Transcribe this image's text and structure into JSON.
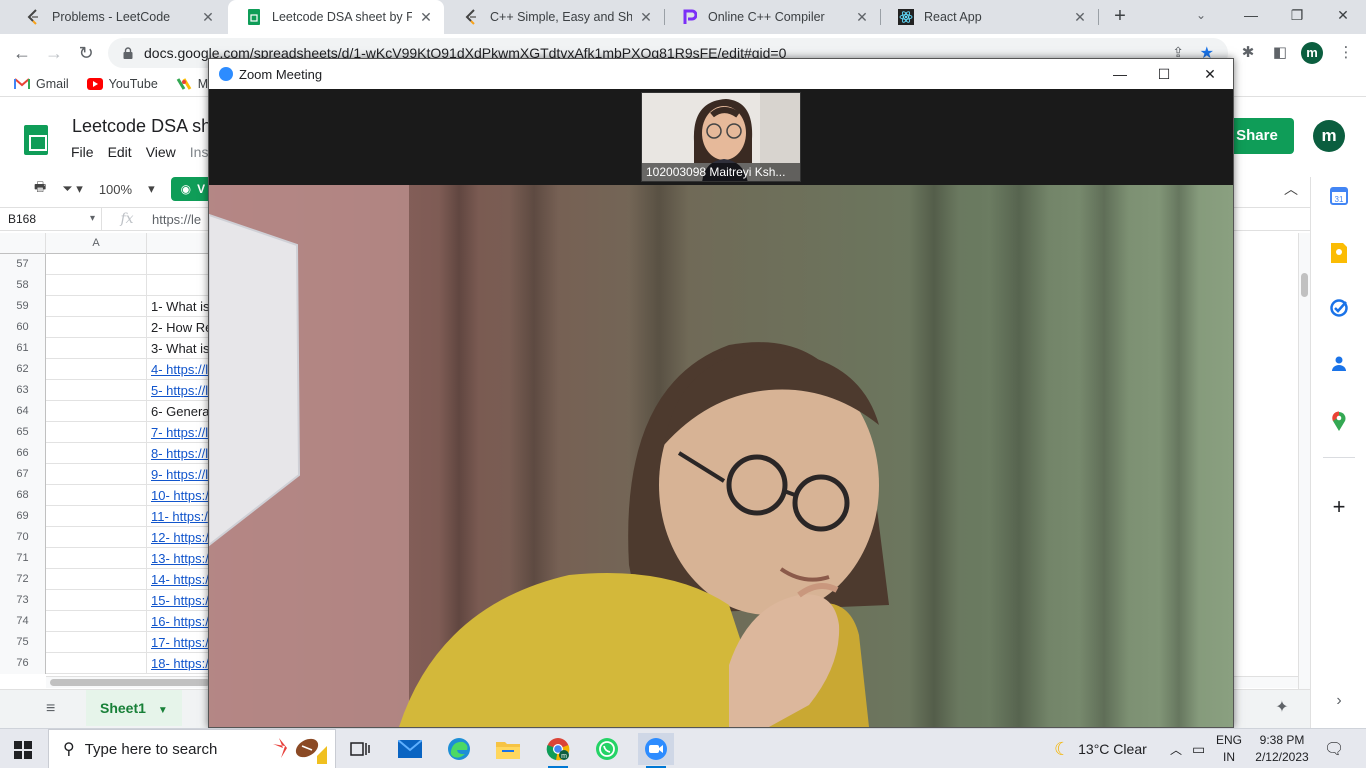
{
  "browser": {
    "tabs": [
      {
        "title": "Problems - LeetCode",
        "active": false
      },
      {
        "title": "Leetcode DSA sheet by Fraz",
        "active": true
      },
      {
        "title": "C++ Simple, Easy and Short S",
        "active": false
      },
      {
        "title": "Online C++ Compiler",
        "active": false
      },
      {
        "title": "React App",
        "active": false
      }
    ],
    "url": "docs.google.com/spreadsheets/d/1-wKcV99KtO91dXdPkwmXGTdtvxAfk1mbPXOg81R9sFE/edit#gid=0",
    "bookmarks": [
      "Gmail",
      "YouTube",
      "Ma"
    ],
    "profile_initial": "m"
  },
  "sheets": {
    "title": "Leetcode DSA sh",
    "menu": [
      "File",
      "Edit",
      "View",
      "Ins"
    ],
    "share_label": "Share",
    "account_initial": "m",
    "zoom_level": "100%",
    "view_label": "V",
    "cell_ref": "B168",
    "formula_text": "https://le",
    "column_a": "A",
    "rows": [
      {
        "n": "57",
        "b": "",
        "link": false
      },
      {
        "n": "58",
        "b": "",
        "link": false
      },
      {
        "n": "59",
        "b": "1- What is",
        "link": false
      },
      {
        "n": "60",
        "b": "2- How Re",
        "link": false
      },
      {
        "n": "61",
        "b": "3- What is",
        "link": false
      },
      {
        "n": "62",
        "b": "4- https://l",
        "link": true
      },
      {
        "n": "63",
        "b": "5- https://l",
        "link": true
      },
      {
        "n": "64",
        "b": "6- Genera",
        "link": false
      },
      {
        "n": "65",
        "b": "7- https://l",
        "link": true
      },
      {
        "n": "66",
        "b": "8- https://l",
        "link": true
      },
      {
        "n": "67",
        "b": "9- https://l",
        "link": true
      },
      {
        "n": "68",
        "b": "10- https:/",
        "link": true
      },
      {
        "n": "69",
        "b": "11- https:/",
        "link": true
      },
      {
        "n": "70",
        "b": "12- https:/",
        "link": true
      },
      {
        "n": "71",
        "b": "13- https:/",
        "link": true
      },
      {
        "n": "72",
        "b": "14- https:/",
        "link": true
      },
      {
        "n": "73",
        "b": "15- https:/",
        "link": true
      },
      {
        "n": "74",
        "b": "16- https:/",
        "link": true
      },
      {
        "n": "75",
        "b": "17- https:/",
        "link": true
      },
      {
        "n": "76",
        "b": "18- https:/",
        "link": true
      }
    ],
    "sheet_tab": "Sheet1"
  },
  "zoom": {
    "window_title": "Zoom Meeting",
    "participant_name": "102003098 Maitreyi Ksh..."
  },
  "taskbar": {
    "search_placeholder": "Type here to search",
    "weather": "13°C  Clear",
    "lang_top": "ENG",
    "lang_bottom": "IN",
    "time": "9:38 PM",
    "date": "2/12/2023"
  },
  "colors": {
    "sheets_green": "#0f9d58",
    "link_blue": "#1155cc",
    "zoom_blue": "#2d8cff",
    "shirt_yellow": "#d3b83a"
  }
}
